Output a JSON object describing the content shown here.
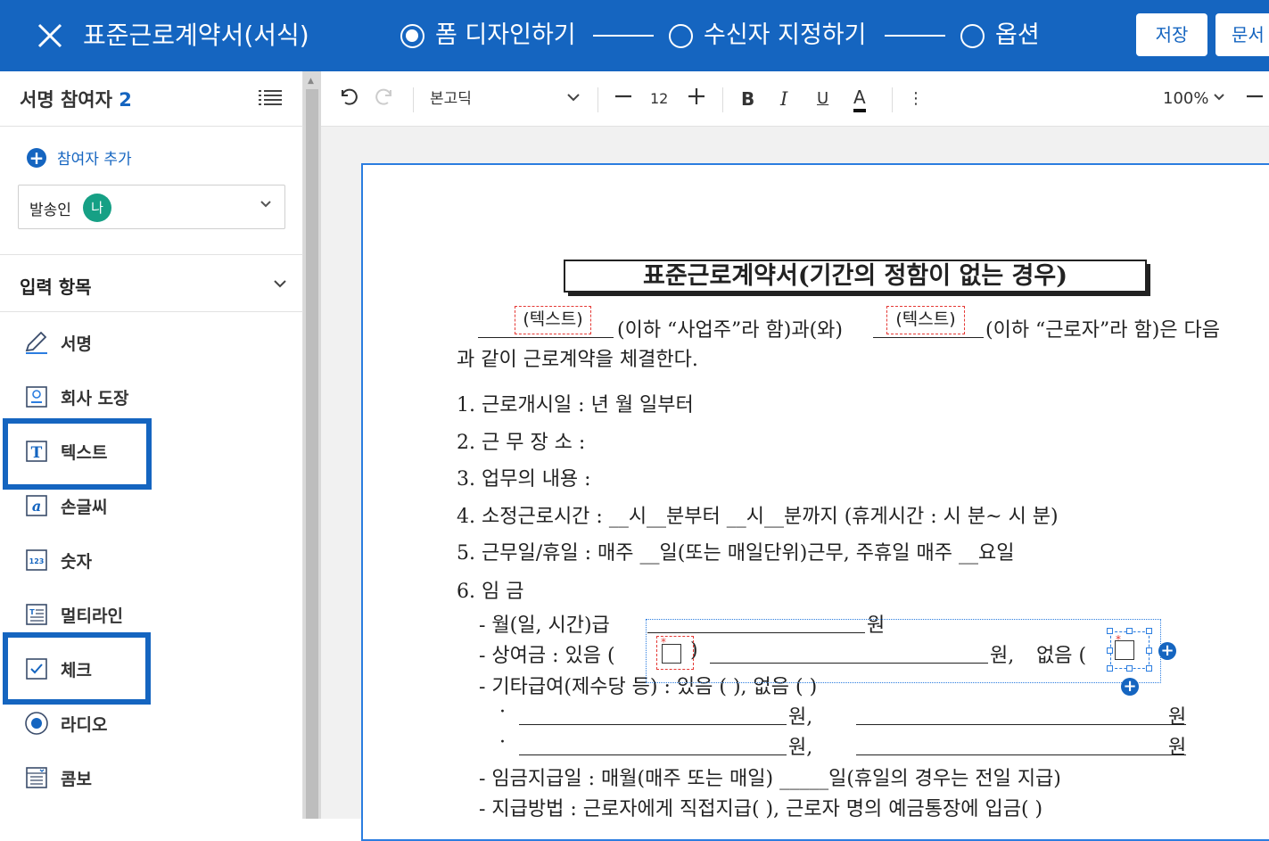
{
  "header": {
    "title": "표준근로계약서(서식)",
    "steps": [
      {
        "label": "폼 디자인하기",
        "active": true
      },
      {
        "label": "수신자 지정하기",
        "active": false
      },
      {
        "label": "옵션",
        "active": false
      }
    ],
    "save_label": "저장",
    "doc_label": "문서"
  },
  "sidebar": {
    "participants_label": "서명 참여자",
    "participants_count": "2",
    "add_participant": "참여자 추가",
    "sender_label": "발송인",
    "sender_badge": "나",
    "input_section": "입력 항목",
    "items": [
      {
        "label": "서명",
        "icon": "pen-icon"
      },
      {
        "label": "회사 도장",
        "icon": "stamp-icon"
      },
      {
        "label": "텍스트",
        "icon": "text-icon"
      },
      {
        "label": "손글씨",
        "icon": "handwriting-icon"
      },
      {
        "label": "숫자",
        "icon": "number-icon"
      },
      {
        "label": "멀티라인",
        "icon": "multiline-icon"
      },
      {
        "label": "체크",
        "icon": "checkbox-icon"
      },
      {
        "label": "라디오",
        "icon": "radio-icon"
      },
      {
        "label": "콤보",
        "icon": "combo-icon"
      }
    ],
    "highlighted_items": [
      "텍스트",
      "체크"
    ]
  },
  "toolbar": {
    "font": "본고딕",
    "font_size": "12",
    "bold": "B",
    "italic": "I",
    "underline": "U",
    "font_color": "A",
    "more": "⋮",
    "zoom": "100%"
  },
  "document": {
    "heading": "표준근로계약서(기간의 정함이 없는 경우)",
    "field_text": "(텍스트)",
    "intro_a": "(이하 “사업주”라 함)과(와)",
    "intro_b": "(이하 “근로자”라 함)은 다음",
    "intro_2": "과 같이 근로계약을 체결한다.",
    "line1": "1. 근로개시일 :        년     월     일부터",
    "line2": "2. 근 무 장 소 :",
    "line3": "3. 업무의 내용 :",
    "line4": "4. 소정근로시간 : __시__분부터 __시__분까지 (휴게시간 :  시  분~  시   분)",
    "line5": "5. 근무일/휴일 : 매주 __일(또는 매일단위)근무, 주휴일 매주 __요일",
    "line6": "6. 임   금",
    "wage1_label": "- 월(일, 시간)급",
    "wage1_unit": "원",
    "bonus_label": "- 상여금 : 있음 (",
    "bonus_close": ")",
    "bonus_unit": "원,",
    "bonus_none": "없음 (",
    "other_label": "- 기타급여(제수당 등) : 있음 (       ),  없음 (     )",
    "dot": "·",
    "won_comma": "원,",
    "won": "원",
    "payday": "- 임금지급일 : 매월(매주 또는 매일)   _____일(휴일의 경우는 전일 지급)",
    "paymethod": "- 지급방법 : 근로자에게 직접지급(     ),  근로자 명의 예금통장에 입금(     )",
    "required_mark": "*"
  },
  "colors": {
    "brand": "#1565c0",
    "badge": "#16a085",
    "field_border": "#e53935",
    "selection": "#2b7de0"
  }
}
